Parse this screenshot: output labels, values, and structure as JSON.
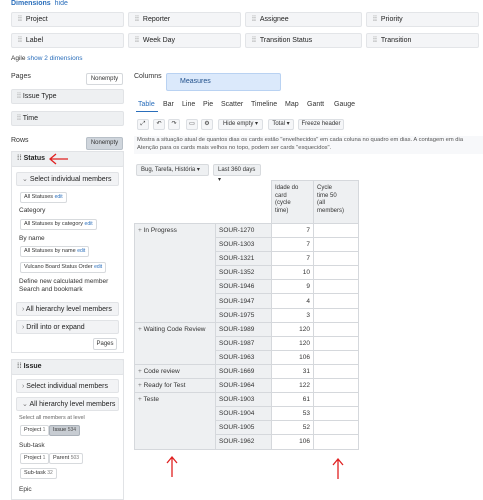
{
  "dimensions": {
    "title": "Dimensions",
    "hide_label": "hide",
    "items": [
      "Project",
      "Reporter",
      "Assignee",
      "Priority",
      "Label",
      "Week Day",
      "Transition Status",
      "Transition"
    ]
  },
  "agile": {
    "label": "Agile",
    "show_link": "show 2 dimensions"
  },
  "pages": {
    "title": "Pages",
    "nonempty_label": "Nonempty",
    "items": [
      "Issue Type",
      "Time"
    ]
  },
  "columns": {
    "title": "Columns",
    "measures_label": "Measures"
  },
  "rows": {
    "title": "Rows",
    "nonempty_label": "Nonempty",
    "status_dim": {
      "title": "Status",
      "select_individual": "Select individual members",
      "all_statuses": "All Statuses",
      "edit": "edit",
      "category_label": "Category",
      "all_statuses_by_category": "All Statuses by category",
      "by_name_label": "By name",
      "all_statuses_by_name": "All Statuses by name",
      "vulcano_board": "Vulcano Board Status Order",
      "define_new": "Define new calculated member",
      "search_bookmark": "Search and bookmark",
      "all_hierarchy": "All hierarchy level members",
      "drill": "Drill into or expand",
      "pages_btn": "Pages"
    },
    "issue_dim": {
      "title": "Issue",
      "select_individual": "Select individual members",
      "all_hierarchy": "All hierarchy level members",
      "select_all_at_level": "Select all members at level",
      "project_chip": "Project",
      "project_count": "1",
      "issue_chip": "Issue",
      "issue_count": "534",
      "subtask_label": "Sub-task",
      "parent_chip": "Parent",
      "parent_count": "503",
      "subtask_chip": "Sub-task",
      "subtask_count": "32",
      "epic_label": "Epic"
    }
  },
  "view_tabs": [
    "Table",
    "Bar",
    "Line",
    "Pie",
    "Scatter",
    "Timeline",
    "Map",
    "Gantt",
    "Gauge"
  ],
  "toolbar": {
    "hide_empty": "Hide empty",
    "total": "Total",
    "freeze_header": "Freeze header"
  },
  "description": {
    "line1": "Mostra a situação atual de quantos dias os cards estão \"envelhecidos\" em cada coluna no quadro em dias. A contagem em dia",
    "line2": "Atenção para os cards mais velhos no topo, podem ser cards \"esquecidos\"."
  },
  "filters": {
    "issue_type": "Bug, Tarefa, História",
    "period": "Last 360 days"
  },
  "table": {
    "headers": {
      "measure1": [
        "Idade do",
        "card",
        "(cycle",
        "time)"
      ],
      "measure2": [
        "Cycle",
        "time 50",
        "(all",
        "members)"
      ]
    },
    "rows": [
      {
        "status": "In Progress",
        "issue": "SOUR-1270",
        "value": "7"
      },
      {
        "status": "",
        "issue": "SOUR-1303",
        "value": "7"
      },
      {
        "status": "",
        "issue": "SOUR-1321",
        "value": "7"
      },
      {
        "status": "",
        "issue": "SOUR-1352",
        "value": "10"
      },
      {
        "status": "",
        "issue": "SOUR-1946",
        "value": "9"
      },
      {
        "status": "",
        "issue": "SOUR-1947",
        "value": "4"
      },
      {
        "status": "",
        "issue": "SOUR-1975",
        "value": "3"
      },
      {
        "status": "Waiting Code Review",
        "issue": "SOUR-1989",
        "value": "120"
      },
      {
        "status": "",
        "issue": "SOUR-1987",
        "value": "120"
      },
      {
        "status": "",
        "issue": "SOUR-1963",
        "value": "106"
      },
      {
        "status": "Code review",
        "issue": "SOUR-1669",
        "value": "31"
      },
      {
        "status": "Ready for Test",
        "issue": "SOUR-1964",
        "value": "122"
      },
      {
        "status": "Teste",
        "issue": "SOUR-1903",
        "value": "61"
      },
      {
        "status": "",
        "issue": "SOUR-1904",
        "value": "53"
      },
      {
        "status": "",
        "issue": "SOUR-1905",
        "value": "52"
      },
      {
        "status": "",
        "issue": "SOUR-1962",
        "value": "106"
      }
    ]
  },
  "colors": {
    "accent": "#2a6ebb",
    "annotation": "#e02020",
    "measures_bg": "#dbe9fb"
  }
}
